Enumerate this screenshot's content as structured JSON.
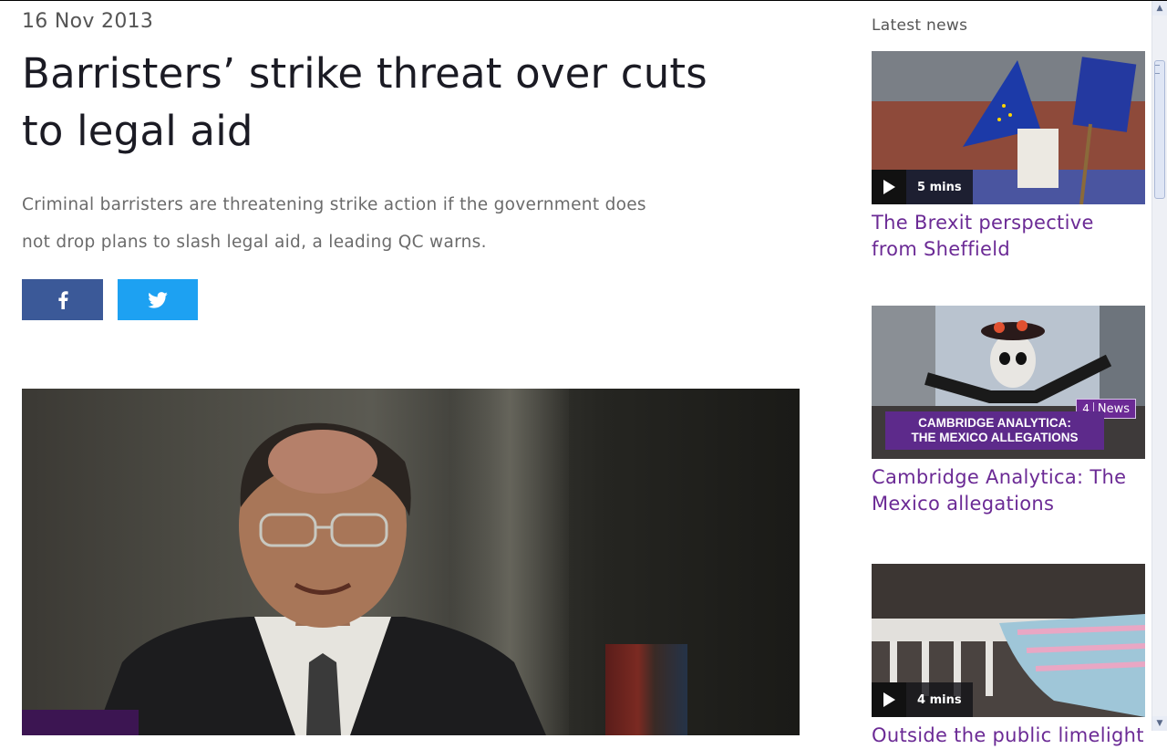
{
  "article": {
    "date": "16 Nov 2013",
    "headline": "Barristers’ strike threat over cuts to legal aid",
    "standfirst": "Criminal barristers are threatening strike action if the government does not drop plans to slash legal aid, a leading QC warns."
  },
  "share": {
    "facebook_icon": "facebook-icon",
    "twitter_icon": "twitter-icon",
    "facebook_color": "#3b5998",
    "twitter_color": "#1da1f2"
  },
  "sidebar": {
    "title": "Latest news",
    "cards": [
      {
        "title": "The Brexit perspective from Sheffield",
        "duration": "5 mins"
      },
      {
        "title": "Cambridge Analytica: The Mexico allegations",
        "badge": "News",
        "banner_line1": "CAMBRIDGE ANALYTICA:",
        "banner_line2": "THE MEXICO ALLEGATIONS"
      },
      {
        "title": "Outside the public limelight",
        "duration": "4 mins"
      }
    ]
  },
  "colors": {
    "headline": "#1b1b24",
    "link": "#6b2a95",
    "accent_purple": "#3c1552"
  }
}
